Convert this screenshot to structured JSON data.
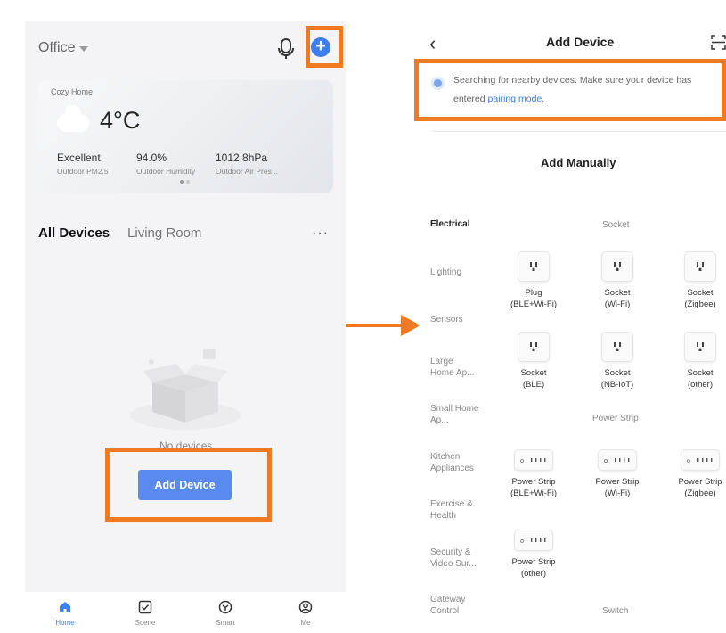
{
  "left": {
    "location": "Office",
    "weather": {
      "home_name": "Cozy Home",
      "temperature": "4°C",
      "stats": [
        {
          "value": "Excellent",
          "label": "Outdoor PM2.5"
        },
        {
          "value": "94.0%",
          "label": "Outdoor Humidity"
        },
        {
          "value": "1012.8hPa",
          "label": "Outdoor Air Pres..."
        }
      ]
    },
    "tabs": {
      "all_devices": "All Devices",
      "living_room": "Living Room"
    },
    "more": "···",
    "empty_text": "No devices",
    "add_device_button": "Add Device",
    "nav": [
      {
        "label": "Home",
        "icon": "home-icon"
      },
      {
        "label": "Scene",
        "icon": "scene-icon"
      },
      {
        "label": "Smart",
        "icon": "smart-icon"
      },
      {
        "label": "Me",
        "icon": "profile-icon"
      }
    ]
  },
  "right": {
    "title": "Add Device",
    "notice_text": "Searching for nearby devices. Make sure your device has entered",
    "notice_link": "pairing mode",
    "notice_end": ".",
    "add_manually": "Add Manually",
    "categories": [
      {
        "label": "Electrical"
      },
      {
        "label": "Lighting"
      },
      {
        "label": "Sensors"
      },
      {
        "label": "Large Home Ap..."
      },
      {
        "label": "Small Home Ap..."
      },
      {
        "label": "Kitchen Appliances"
      },
      {
        "label": "Exercise & Health"
      },
      {
        "label": "Security & Video Sur..."
      },
      {
        "label": "Gateway Control"
      }
    ],
    "sections": {
      "socket": "Socket",
      "power_strip": "Power Strip",
      "switch": "Switch"
    },
    "sockets": [
      {
        "name": "Plug",
        "sub": "(BLE+Wi-Fi)"
      },
      {
        "name": "Socket",
        "sub": "(Wi-Fi)"
      },
      {
        "name": "Socket",
        "sub": "(Zigbee)"
      },
      {
        "name": "Socket",
        "sub": "(BLE)"
      },
      {
        "name": "Socket",
        "sub": "(NB-IoT)"
      },
      {
        "name": "Socket",
        "sub": "(other)"
      }
    ],
    "strips": [
      {
        "name": "Power Strip",
        "sub": "(BLE+Wi-Fi)"
      },
      {
        "name": "Power Strip",
        "sub": "(Wi-Fi)"
      },
      {
        "name": "Power Strip",
        "sub": "(Zigbee)"
      },
      {
        "name": "Power Strip",
        "sub": "(other)"
      }
    ]
  },
  "colors": {
    "accent": "#3f7ef0",
    "highlight": "#f07a22",
    "button": "#5a8af0"
  }
}
